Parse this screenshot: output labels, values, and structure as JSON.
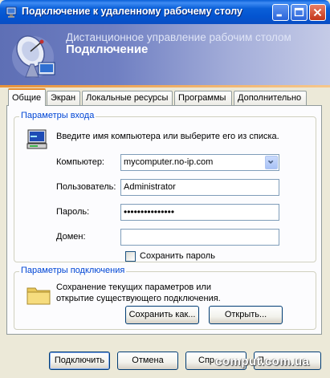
{
  "window": {
    "title": "Подключение к удаленному рабочему столу"
  },
  "banner": {
    "line1": "Дистанционное управление рабочим столом",
    "line2": "Подключение"
  },
  "tabs": [
    {
      "label": "Общие",
      "active": true
    },
    {
      "label": "Экран"
    },
    {
      "label": "Локальные ресурсы"
    },
    {
      "label": "Программы"
    },
    {
      "label": "Дополнительно"
    }
  ],
  "login_group": {
    "title": "Параметры входа",
    "hint": "Введите имя компьютера или выберите его из списка.",
    "computer_label": "Компьютер:",
    "computer_value": "mycomputer.no-ip.com",
    "user_label": "Пользователь:",
    "user_value": "Administrator",
    "password_label": "Пароль:",
    "password_value": "•••••••••••••••",
    "domain_label": "Домен:",
    "domain_value": "",
    "save_password_label": "Сохранить пароль"
  },
  "connection_group": {
    "title": "Параметры подключения",
    "hint": "Сохранение текущих параметров или открытие существующего подключения.",
    "save_as_label": "Сохранить как...",
    "open_label": "Открыть..."
  },
  "footer": {
    "connect_label": "Подключить",
    "cancel_label": "Отмена",
    "help_label": "Спр",
    "params_label": "П"
  },
  "watermark": "comput.com.ua"
}
